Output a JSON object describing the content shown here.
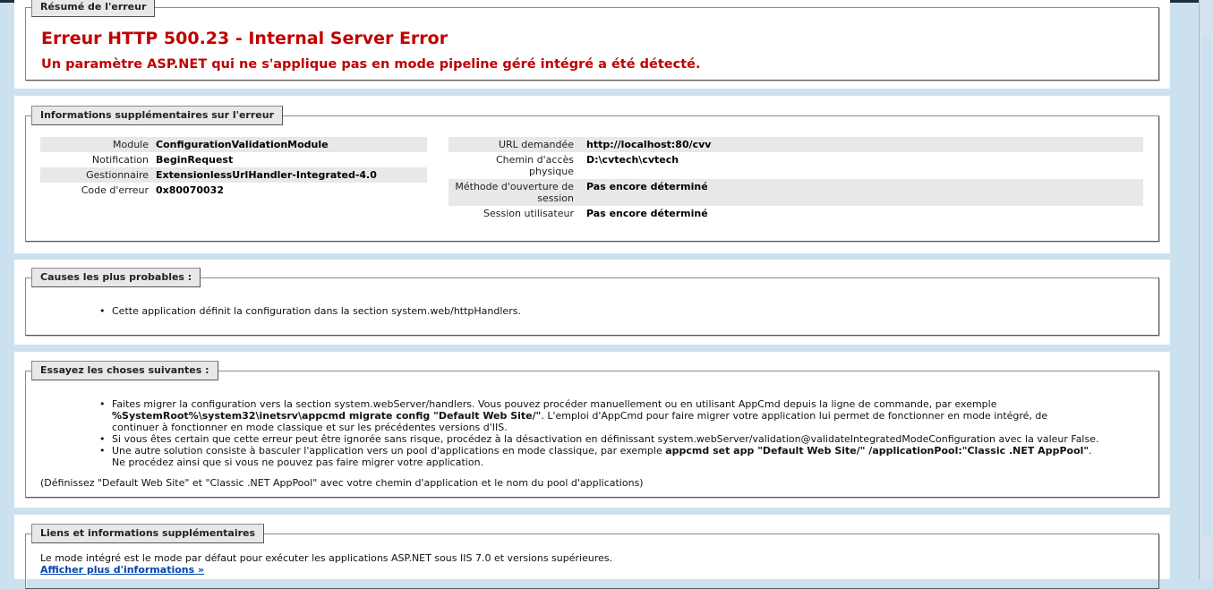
{
  "summary": {
    "legend": "Résumé de l'erreur",
    "title": "Erreur HTTP 500.23 - Internal Server Error",
    "subtitle": "Un paramètre ASP.NET qui ne s'applique pas en mode pipeline géré intégré a été détecté."
  },
  "details": {
    "legend": "Informations supplémentaires sur l'erreur",
    "left": [
      {
        "key": "Module",
        "value": "ConfigurationValidationModule"
      },
      {
        "key": "Notification",
        "value": "BeginRequest"
      },
      {
        "key": "Gestionnaire",
        "value": "ExtensionlessUrlHandler-Integrated-4.0"
      },
      {
        "key": "Code d'erreur",
        "value": "0x80070032"
      }
    ],
    "right": [
      {
        "key": "URL demandée",
        "value": "http://localhost:80/cvv"
      },
      {
        "key": "Chemin d'accès physique",
        "value": "D:\\cvtech\\cvtech"
      },
      {
        "key": "Méthode d'ouverture de session",
        "value": "Pas encore déterminé"
      },
      {
        "key": "Session utilisateur",
        "value": "Pas encore déterminé"
      }
    ]
  },
  "causes": {
    "legend": "Causes les plus probables :",
    "items": [
      "Cette application définit la configuration dans la section system.web/httpHandlers."
    ]
  },
  "try": {
    "legend": "Essayez les choses suivantes :",
    "item1_a": "Faites migrer la configuration vers la section system.webServer/handlers. Vous pouvez procéder manuellement ou en utilisant AppCmd depuis la ligne de commande, par exemple",
    "item1_cmd": "%SystemRoot%\\system32\\inetsrv\\appcmd migrate config \"Default Web Site/\"",
    "item1_b": ". L'emploi d'AppCmd pour faire migrer votre application lui permet de fonctionner en mode intégré, de",
    "item1_c": "continuer à fonctionner en mode classique et sur les précédentes versions d'IIS.",
    "item2": "Si vous êtes certain que cette erreur peut être ignorée sans risque, procédez à la désactivation en définissant system.webServer/validation@validateIntegratedModeConfiguration avec la valeur False.",
    "item3_a": "Une autre solution consiste à basculer l'application vers un pool d'applications en mode classique, par exemple",
    "item3_cmd": "appcmd set app \"Default Web Site/\" /applicationPool:\"Classic .NET AppPool\"",
    "item3_b": ".",
    "item3_c": "Ne procédez ainsi que si vous ne pouvez pas faire migrer votre application.",
    "note": "(Définissez \"Default Web Site\" et \"Classic .NET AppPool\" avec votre chemin d'application et le nom du pool d'applications)"
  },
  "links": {
    "legend": "Liens et informations supplémentaires",
    "text": "Le mode intégré est le mode par défaut pour exécuter les applications ASP.NET sous IIS 7.0 et versions supérieures.",
    "more_link": "Afficher plus d'informations »"
  },
  "bullet_char": "•"
}
